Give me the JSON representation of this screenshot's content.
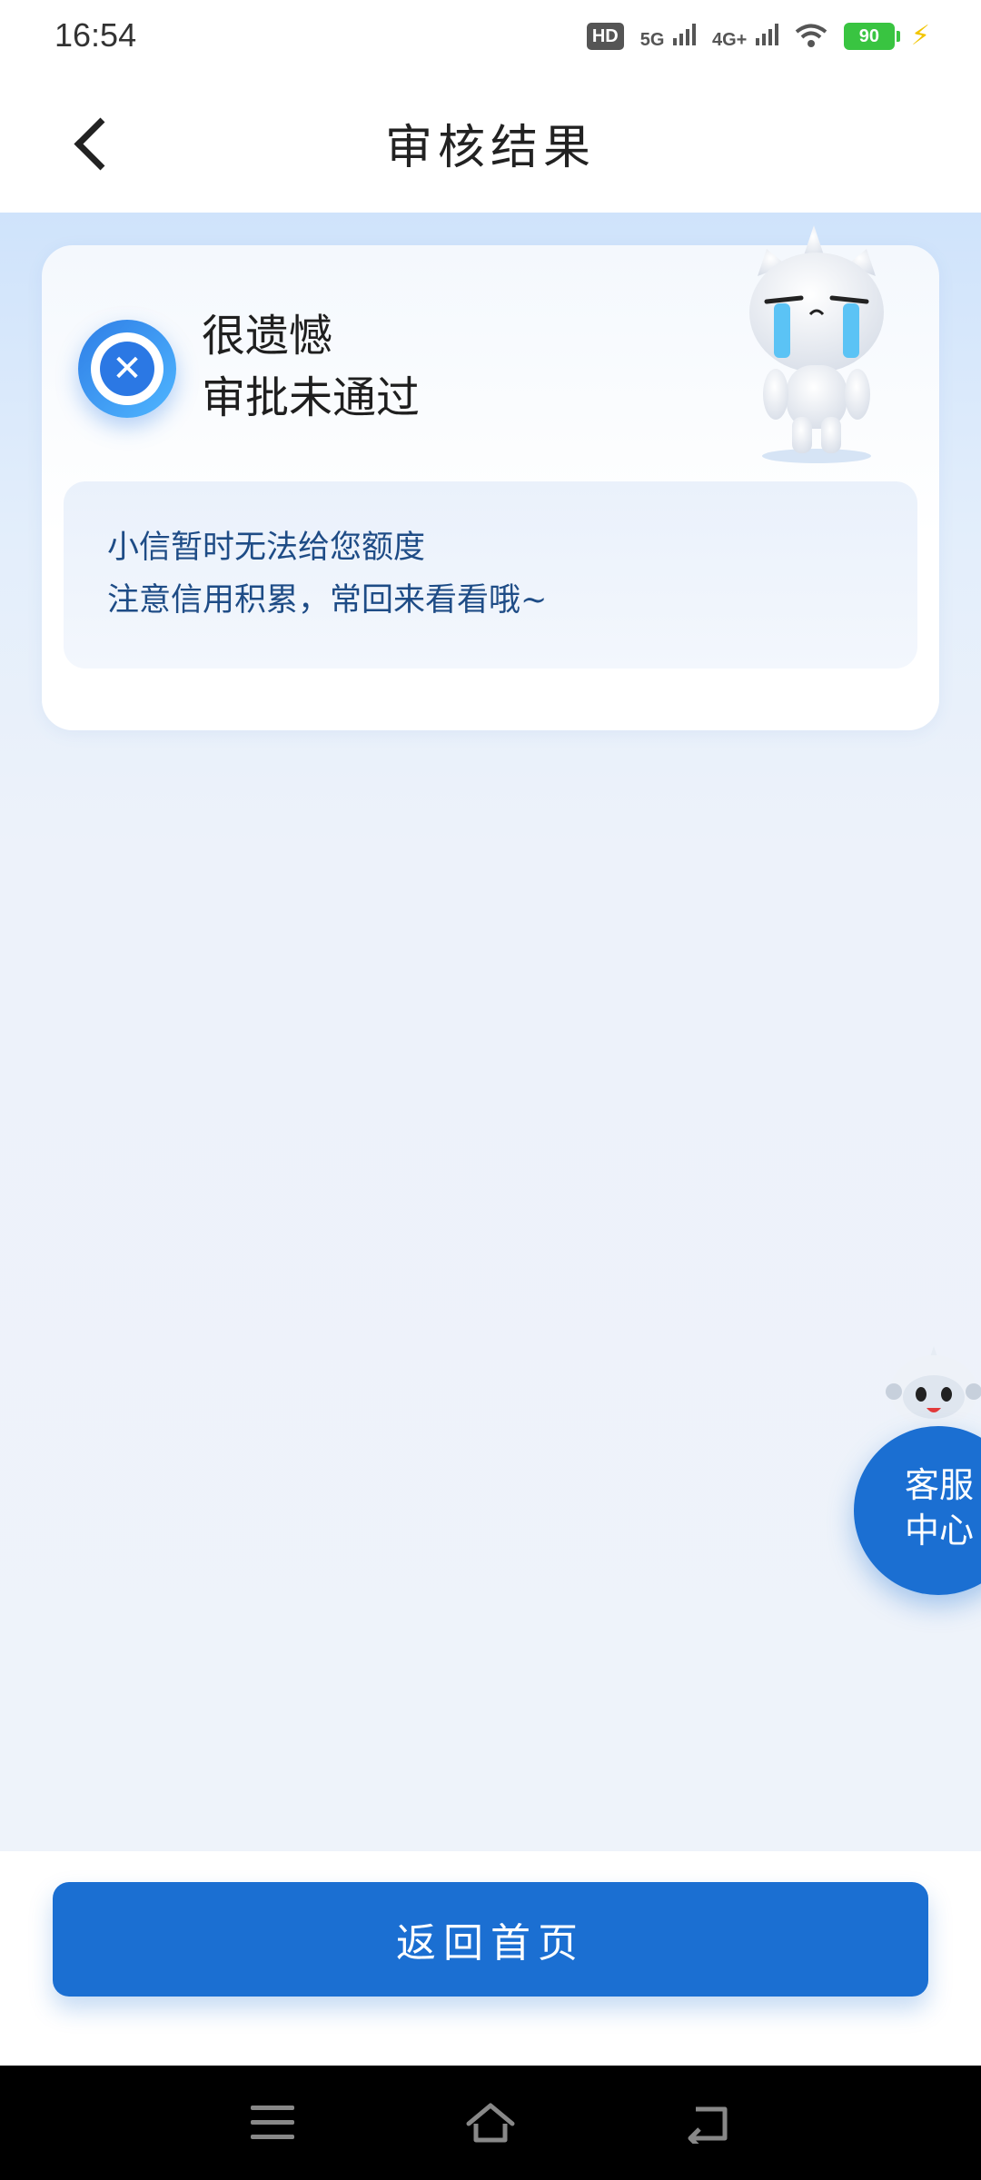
{
  "status_bar": {
    "time": "16:54",
    "hd_badge": "HD",
    "sim_indicator": "1\n2",
    "network_1": "5G",
    "network_2": "4G+",
    "battery": "90"
  },
  "header": {
    "title": "审核结果"
  },
  "result_card": {
    "headline_line1": "很遗憾",
    "headline_line2": "审批未通过",
    "message_line1": "小信暂时无法给您额度",
    "message_line2": "注意信用积累，常回来看看哦~"
  },
  "customer_service": {
    "line1": "客服",
    "line2": "中心"
  },
  "footer": {
    "home_button_label": "返回首页"
  },
  "colors": {
    "primary": "#1b6fd2",
    "message_text": "#1e4c86",
    "battery": "#39c441"
  },
  "icons": [
    "back-chevron-icon",
    "fail-x-icon",
    "crying-mascot-icon",
    "robot-mascot-icon",
    "menu-icon",
    "home-icon",
    "back-icon"
  ]
}
